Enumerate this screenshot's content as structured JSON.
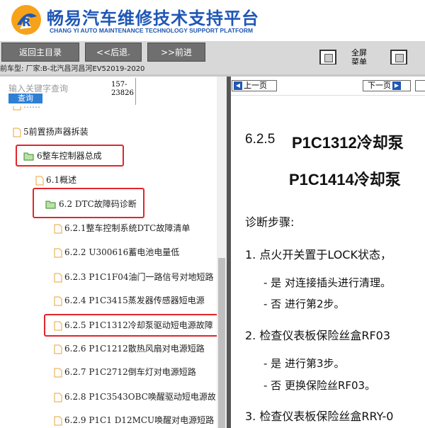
{
  "brand": {
    "title_cn": "畅易汽车维修技术支持平台",
    "title_en": "CHANG YI AUTO MAINTENANCE TECHNOLOGY SUPPORT PLATFORM",
    "logo_icon": "cy-logo-icon"
  },
  "toolbar": {
    "back_main": "返回主目录",
    "back": "<<后退.",
    "forward": ">>前进",
    "fullscreen_line1": "全屏",
    "fullscreen_line2": "菜单"
  },
  "vehicle_info": "前车型:  厂家:B-北汽昌河昌河EV52019-2020",
  "search": {
    "placeholder": "输入关键字查询",
    "button": "查询",
    "phone_line1": "157-",
    "phone_line2": "23826"
  },
  "tree": [
    {
      "label": "5前置扬声器拆装",
      "icon": "doc-icon"
    },
    {
      "label": "6整车控制器总成",
      "icon": "folder-open-icon"
    },
    {
      "label": "6.1概述",
      "icon": "doc-icon"
    },
    {
      "label": "6.2 DTC故障码诊断",
      "icon": "folder-open-icon"
    },
    {
      "label": "6.2.1整车控制系统DTC故障清单",
      "icon": "doc-icon"
    },
    {
      "label": "6.2.2 U300616蓄电池电量低",
      "icon": "doc-icon"
    },
    {
      "label": "6.2.3 P1C1F04油门一路信号对地短路",
      "icon": "doc-icon"
    },
    {
      "label": "6.2.4 P1C3415蒸发器传感器短电源",
      "icon": "doc-icon"
    },
    {
      "label": "6.2.5 P1C1312冷却泵驱动短电源故障",
      "icon": "doc-icon"
    },
    {
      "label": "6.2.6 P1C1212散热风扇对电源短路",
      "icon": "doc-icon"
    },
    {
      "label": "6.2.7 P1C2712倒车灯对电源短路",
      "icon": "doc-icon"
    },
    {
      "label": "6.2.8 P1C3543OBC唤醒驱动短电源故",
      "icon": "doc-icon"
    },
    {
      "label": "6.2.9 P1C1 D12MCU唤醒对电源短路",
      "icon": "doc-icon"
    }
  ],
  "viewer": {
    "prev_page": "上一页",
    "next_page": "下一页",
    "next_icon": "arrow-right-icon",
    "prev_icon": "arrow-left-icon",
    "heading_num": "6.2.5",
    "heading_code1": "P1C1312冷却泵",
    "heading_code2": "P1C1414冷却泵",
    "steps_title": "诊断步骤:",
    "step1": "1. 点火开关置于LOCK状态，",
    "step1_yes": "- 是 对连接插头进行清理。",
    "step1_no": "- 否 进行第2步。",
    "step2": "2. 检查仪表板保险丝盒RF03",
    "step2_yes": "- 是 进行第3步。",
    "step2_no": "- 否 更换保险丝RF03。",
    "step3": "3. 检查仪表板保险丝盒RRY-0"
  },
  "colors": {
    "brand_blue": "#1f57b6",
    "highlight_red": "#e0262a",
    "toolbar_gray": "#6f6f6f"
  }
}
